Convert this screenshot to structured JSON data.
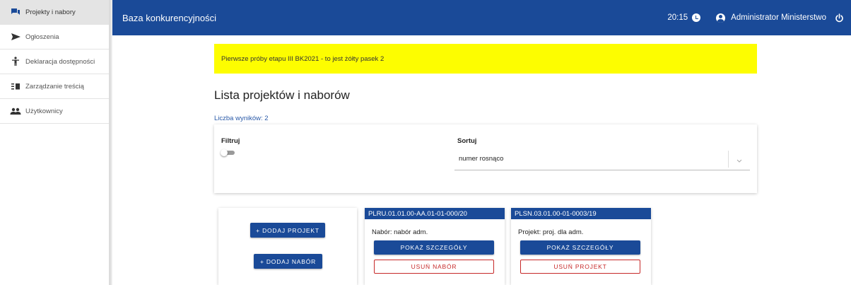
{
  "sidebar": {
    "items": [
      {
        "label": "Projekty i nabory",
        "icon": "chat-icon",
        "active": true
      },
      {
        "label": "Ogłoszenia",
        "icon": "send-icon",
        "active": false
      },
      {
        "label": "Deklaracja dostępności",
        "icon": "accessibility-icon",
        "active": false
      },
      {
        "label": "Zarządzanie treścią",
        "icon": "content-icon",
        "active": false
      },
      {
        "label": "Użytkownicy",
        "icon": "users-icon",
        "active": false
      }
    ]
  },
  "header": {
    "title": "Baza konkurencyjności",
    "time": "20:15",
    "user_name": "Administrator Ministerstwo"
  },
  "banner": {
    "text": "Pierwsze próby etapu III BK2021 - to jest żółty pasek 2",
    "color": "#fdfd00"
  },
  "main": {
    "title": "Lista projektów i naborów",
    "count_label": "Liczba wyników: 2"
  },
  "filters": {
    "filter_label": "Filtruj",
    "filter_enabled": false,
    "sort_label": "Sortuj",
    "sort_value": "numer rosnąco"
  },
  "actions": {
    "add_project": "+ DODAJ PROJEKT",
    "add_recruitment": "+ DODAJ NABÓR"
  },
  "cards": [
    {
      "code": "PLRU.01.01.00-AA.01-01-000/20",
      "description": "Nabór: nabór adm.",
      "details_label": "POKAŻ SZCZEGÓŁY",
      "delete_label": "USUŃ NABÓR"
    },
    {
      "code": "PLSN.03.01.00-01-0003/19",
      "description": "Projekt: proj. dla adm.",
      "details_label": "POKAŻ SZCZEGÓŁY",
      "delete_label": "USUŃ PROJEKT"
    }
  ],
  "colors": {
    "primary": "#1a4a98",
    "danger": "#c62828",
    "link": "#2a5aa8"
  }
}
